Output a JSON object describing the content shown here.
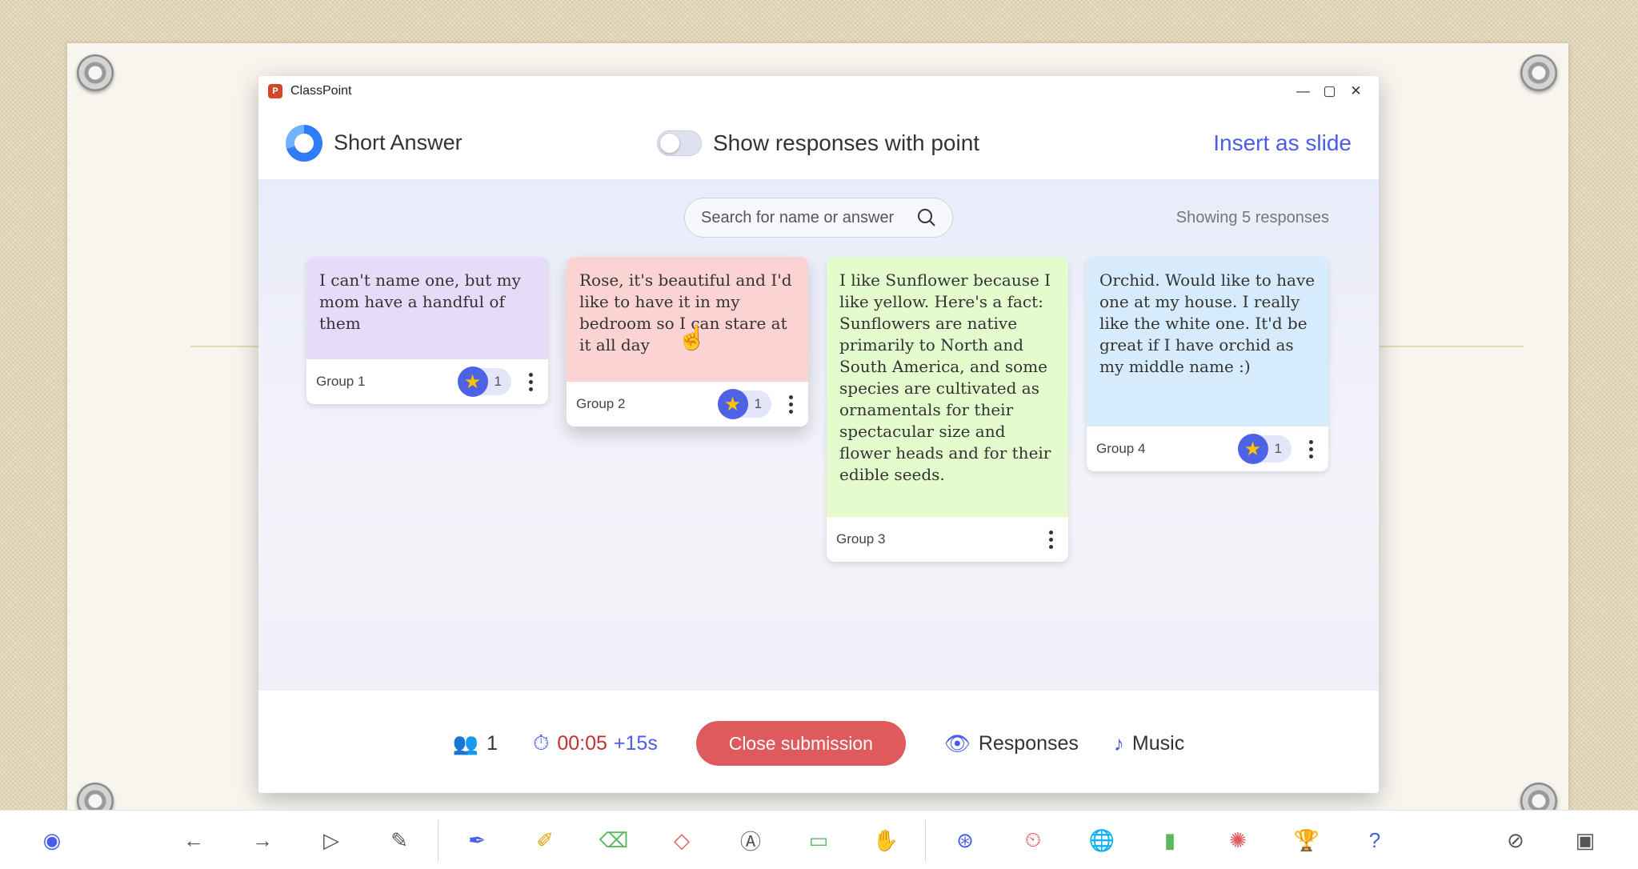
{
  "window": {
    "app_title": "ClassPoint",
    "minimize": "—",
    "maximize": "▢",
    "close": "✕"
  },
  "header": {
    "title": "Short Answer",
    "toggle_label": "Show responses with point",
    "toggle_on": false,
    "insert_label": "Insert as slide"
  },
  "search": {
    "placeholder": "Search for name or answer"
  },
  "showing_text": "Showing 5 responses",
  "cards": [
    {
      "text": "I can't name one, but my mom have a handful of them",
      "group": "Group 1",
      "stars": "1",
      "color": "#e6dcfa"
    },
    {
      "text": "Rose, it's beautiful and I'd like to have it in my bedroom so I can stare at it all day",
      "group": "Group 2",
      "stars": "1",
      "color": "#fbd3d3"
    },
    {
      "text": "I like Sunflower because I like yellow. Here's a fact: Sunflowers are native primarily to North and South America, and some species are cultivated as ornamentals for their spectacular size and flower heads and for their edible seeds.",
      "group": "Group 3",
      "stars": "",
      "color": "#e4fbcd"
    },
    {
      "text": "Orchid. Would like to have one at my house. I really like the white one. It'd be great if I have orchid as my middle name :)",
      "group": "Group 4",
      "stars": "1",
      "color": "#d6ecfd"
    }
  ],
  "footer": {
    "participants": "1",
    "timer": "00:05",
    "timer_extra": "+15s",
    "close_label": "Close submission",
    "responses_label": "Responses",
    "music_label": "Music"
  },
  "colors": {
    "accent": "#4a5de8",
    "close_button": "#de5a5c",
    "timer": "#c53030"
  },
  "taskbar_icons": [
    "classpoint-icon",
    "back-arrow-icon",
    "forward-arrow-icon",
    "pointer-icon",
    "laser-pen-icon",
    "pen-icon",
    "highlighter-icon",
    "eraser-icon",
    "shapes-icon",
    "text-box-icon",
    "whiteboard-icon",
    "drag-hand-icon",
    "ai-icon",
    "timer-icon",
    "browser-icon",
    "chart-icon",
    "wheel-icon",
    "trophy-icon",
    "help-icon",
    "hide-icon",
    "end-slideshow-icon"
  ]
}
